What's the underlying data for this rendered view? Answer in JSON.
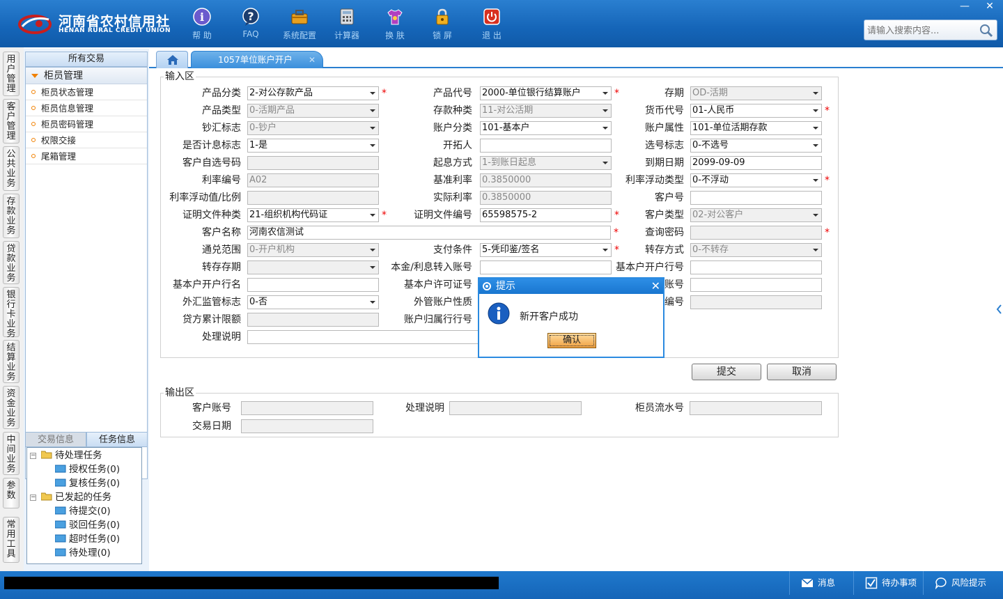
{
  "app": {
    "name_cn": "河南省农村信用社",
    "name_en": "HENAN RURAL CREDIT UNION",
    "brand_color": "#1565b8",
    "accent_red": "#c81e1e"
  },
  "toolbar": [
    {
      "label": "帮 助",
      "icon": "help-icon"
    },
    {
      "label": "FAQ",
      "icon": "faq-icon"
    },
    {
      "label": "系统配置",
      "icon": "toolbox-icon"
    },
    {
      "label": "计算器",
      "icon": "calculator-icon"
    },
    {
      "label": "换 肤",
      "icon": "skin-shirt-icon"
    },
    {
      "label": "锁 屏",
      "icon": "lock-icon"
    },
    {
      "label": "退 出",
      "icon": "power-icon"
    }
  ],
  "window_controls": {
    "minimize": "—",
    "close": "✕"
  },
  "search": {
    "placeholder": "请输入搜索内容..."
  },
  "vertical_tabs": [
    "用户管理",
    "客户管理",
    "公共业务",
    "存款业务",
    "贷款业务",
    "银行卡业务",
    "结算业务",
    "资金业务",
    "中间业务",
    "参数",
    "常用工具"
  ],
  "left_panel": {
    "title": "所有交易",
    "group": "柜员管理",
    "items": [
      "柜员状态管理",
      "柜员信息管理",
      "柜员密码管理",
      "权限交接",
      "尾箱管理"
    ],
    "task_tabs": [
      "交易信息",
      "任务信息"
    ],
    "tree": {
      "pending": "待处理任务",
      "pending_children": [
        "授权任务(0)",
        "复核任务(0)"
      ],
      "initiated": "已发起的任务",
      "initiated_children": [
        "待提交(0)",
        "驳回任务(0)",
        "超时任务(0)",
        "待处理(0)"
      ]
    }
  },
  "tabs": {
    "active_label": "1057单位账户开户",
    "close": "✕"
  },
  "input_area": {
    "legend": "输入区",
    "rows": [
      [
        {
          "label": "产品分类",
          "value": "2-对公存款产品",
          "type": "select",
          "req": true
        },
        {
          "label": "产品代号",
          "value": "2000-单位银行结算账户",
          "type": "select",
          "req": true
        },
        {
          "label": "存期",
          "value": "OD-活期",
          "type": "select",
          "disabled": true
        }
      ],
      [
        {
          "label": "产品类型",
          "value": "0-活期产品",
          "type": "select",
          "disabled": true
        },
        {
          "label": "存款种类",
          "value": "11-对公活期",
          "type": "select",
          "disabled": true
        },
        {
          "label": "货币代号",
          "value": "01-人民币",
          "type": "select",
          "req": true
        }
      ],
      [
        {
          "label": "钞汇标志",
          "value": "0-钞户",
          "type": "select",
          "disabled": true
        },
        {
          "label": "账户分类",
          "value": "101-基本户",
          "type": "select"
        },
        {
          "label": "账户属性",
          "value": "101-单位活期存款",
          "type": "select"
        }
      ],
      [
        {
          "label": "是否计息标志",
          "value": "1-是",
          "type": "select"
        },
        {
          "label": "开拓人",
          "value": "",
          "type": "text"
        },
        {
          "label": "选号标志",
          "value": "0-不选号",
          "type": "select"
        }
      ],
      [
        {
          "label": "客户自选号码",
          "value": "",
          "type": "text",
          "disabled": true
        },
        {
          "label": "起息方式",
          "value": "1-到账日起息",
          "type": "select",
          "disabled": true
        },
        {
          "label": "到期日期",
          "value": "2099-09-09",
          "type": "text"
        }
      ],
      [
        {
          "label": "利率编号",
          "value": "A02",
          "type": "text",
          "disabled": true
        },
        {
          "label": "基准利率",
          "value": "0.3850000",
          "type": "text",
          "disabled": true
        },
        {
          "label": "利率浮动类型",
          "value": "0-不浮动",
          "type": "select",
          "req": true
        }
      ],
      [
        {
          "label": "利率浮动值/比例",
          "value": "",
          "type": "text",
          "disabled": true
        },
        {
          "label": "实际利率",
          "value": "0.3850000",
          "type": "text",
          "disabled": true
        },
        {
          "label": "客户号",
          "value": "",
          "type": "text"
        }
      ],
      [
        {
          "label": "证明文件种类",
          "value": "21-组织机构代码证",
          "type": "select",
          "req": true
        },
        {
          "label": "证明文件编号",
          "value": "65598575-2",
          "type": "text",
          "req": true
        },
        {
          "label": "客户类型",
          "value": "02-对公客户",
          "type": "select",
          "disabled": true
        }
      ],
      [
        {
          "label": "客户名称",
          "value": "河南农信测试",
          "type": "wide",
          "req": true
        },
        {
          "label": "查询密码",
          "value": "",
          "type": "text",
          "disabled": true,
          "req": true
        }
      ],
      [
        {
          "label": "通兑范围",
          "value": "0-开户机构",
          "type": "select",
          "disabled": true
        },
        {
          "label": "支付条件",
          "value": "5-凭印鉴/签名",
          "type": "select",
          "req": true
        },
        {
          "label": "转存方式",
          "value": "0-不转存",
          "type": "select",
          "disabled": true
        }
      ],
      [
        {
          "label": "转存存期",
          "value": "",
          "type": "select",
          "disabled": true
        },
        {
          "label": "本金/利息转入账号",
          "value": "",
          "type": "text"
        },
        {
          "label": "基本户开户行号",
          "value": "",
          "type": "text"
        }
      ],
      [
        {
          "label": "基本户开户行名",
          "value": "",
          "type": "text"
        },
        {
          "label": "基本户许可证号",
          "value": "",
          "type": "text"
        },
        {
          "label": "账号",
          "value": "",
          "type": "text"
        }
      ],
      [
        {
          "label": "外汇监管标志",
          "value": "0-否",
          "type": "select"
        },
        {
          "label": "外管账户性质",
          "value": "",
          "type": "text"
        },
        {
          "label": "编号",
          "value": "",
          "type": "text",
          "disabled": true
        }
      ],
      [
        {
          "label": "贷方累计限额",
          "value": "",
          "type": "text",
          "disabled": true
        },
        {
          "label": "账户归属行行号",
          "value": "",
          "type": "text"
        }
      ],
      [
        {
          "label": "处理说明",
          "value": "",
          "type": "wide"
        }
      ]
    ]
  },
  "buttons": {
    "submit": "提交",
    "cancel": "取消"
  },
  "output_area": {
    "legend": "输出区",
    "fields": [
      {
        "label": "客户账号",
        "value": ""
      },
      {
        "label": "处理说明",
        "value": ""
      },
      {
        "label": "柜员流水号",
        "value": ""
      },
      {
        "label": "交易日期",
        "value": ""
      }
    ]
  },
  "dialog": {
    "title": "提示",
    "message": "新开客户成功",
    "ok": "确认",
    "close": "✕"
  },
  "statusbar": {
    "messages": "消息",
    "todo": "待办事项",
    "risk": "风险提示"
  }
}
